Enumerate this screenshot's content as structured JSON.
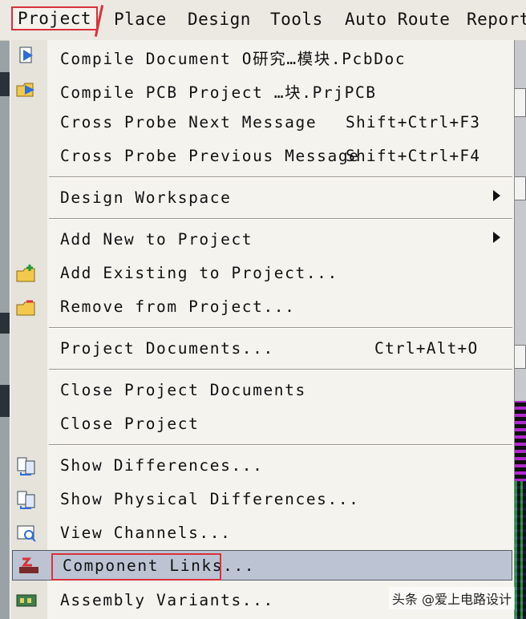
{
  "menubar": {
    "items": [
      "Project",
      "Place",
      "Design",
      "Tools",
      "Auto Route",
      "Report"
    ]
  },
  "menu": {
    "items": [
      {
        "label": "Compile Document O研究…模块.PcbDoc",
        "shortcut": ""
      },
      {
        "label": "Compile PCB Project …块.PrjPCB",
        "shortcut": ""
      },
      {
        "label": "Cross Probe Next Message",
        "shortcut": "Shift+Ctrl+F3"
      },
      {
        "label": "Cross Probe Previous Message",
        "shortcut": "Shift+Ctrl+F4"
      },
      {
        "label": "Design Workspace",
        "shortcut": ""
      },
      {
        "label": "Add New to Project",
        "shortcut": ""
      },
      {
        "label": "Add Existing to Project...",
        "shortcut": ""
      },
      {
        "label": "Remove from Project...",
        "shortcut": ""
      },
      {
        "label": "Project Documents...",
        "shortcut": "Ctrl+Alt+O"
      },
      {
        "label": "Close Project Documents",
        "shortcut": ""
      },
      {
        "label": "Close Project",
        "shortcut": ""
      },
      {
        "label": "Show Differences...",
        "shortcut": ""
      },
      {
        "label": "Show Physical Differences...",
        "shortcut": ""
      },
      {
        "label": "View Channels...",
        "shortcut": ""
      },
      {
        "label": "Component Links...",
        "shortcut": ""
      },
      {
        "label": "Assembly Variants...",
        "shortcut": ""
      }
    ]
  },
  "watermark": "头条 @爱上电路设计",
  "colors": {
    "highlight": "#bcc4d4",
    "annotation": "#d8323a"
  }
}
